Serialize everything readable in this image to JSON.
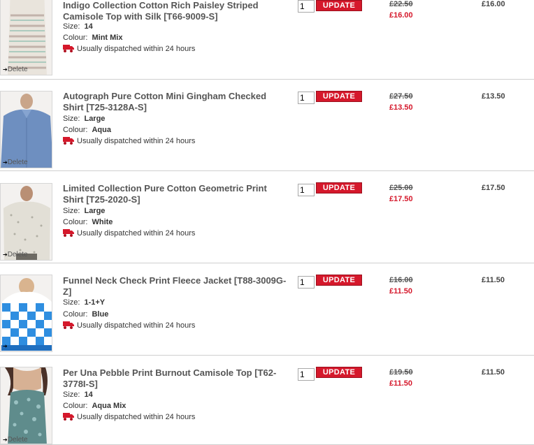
{
  "common": {
    "delete_label": "Delete",
    "update_label": "UPDATE",
    "size_label": "Size:",
    "colour_label": "Colour:",
    "dispatch_text": "Usually dispatched within 24 hours",
    "delete_arrow_icon": "arrow-right-icon",
    "dispatch_icon": "delivery-truck-icon",
    "accent_color": "#d5182b"
  },
  "items": [
    {
      "title": "Indigo Collection Cotton Rich Paisley Striped Camisole Top with Silk [T66-9009-S]",
      "size": "14",
      "colour": "Mint Mix",
      "qty": "1",
      "was_price": "£22.50",
      "now_price": "£16.00",
      "total": "£16.00"
    },
    {
      "title": "Autograph Pure Cotton Mini Gingham Checked Shirt [T25-3128A-S]",
      "size": "Large",
      "colour": "Aqua",
      "qty": "1",
      "was_price": "£27.50",
      "now_price": "£13.50",
      "total": "£13.50"
    },
    {
      "title": "Limited Collection Pure Cotton Geometric Print Shirt [T25-2020-S]",
      "size": "Large",
      "colour": "White",
      "qty": "1",
      "was_price": "£25.00",
      "now_price": "£17.50",
      "total": "£17.50"
    },
    {
      "title": "Funnel Neck Check Print Fleece Jacket [T88-3009G-Z]",
      "size": "1-1+Y",
      "colour": "Blue",
      "qty": "1",
      "was_price": "£16.00",
      "now_price": "£11.50",
      "total": "£11.50"
    },
    {
      "title": "Per Una Pebble Print Burnout Camisole Top [T62-3778I-S]",
      "size": "14",
      "colour": "Aqua Mix",
      "qty": "1",
      "was_price": "£19.50",
      "now_price": "£11.50",
      "total": "£11.50"
    }
  ]
}
